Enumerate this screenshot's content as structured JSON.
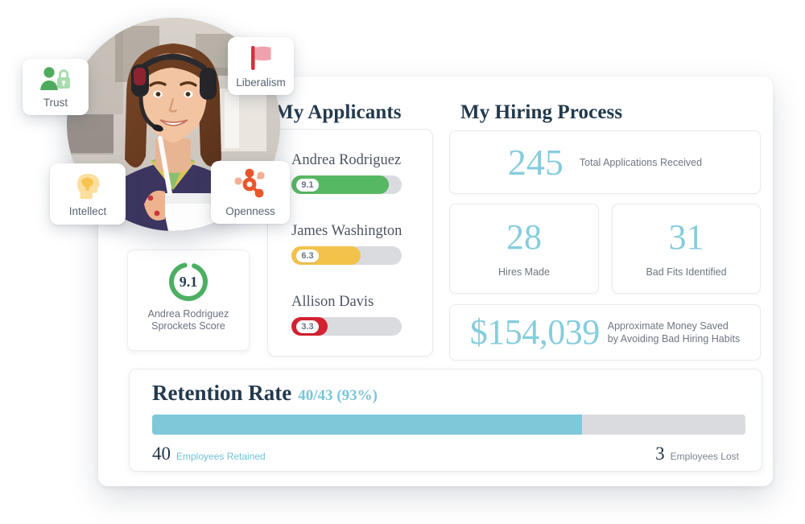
{
  "traits": [
    {
      "id": "trust",
      "label": "Trust",
      "icon": "person-lock-icon",
      "color": "#5cb36a"
    },
    {
      "id": "liberalism",
      "label": "Liberalism",
      "icon": "flag-icon",
      "color": "#e4707e"
    },
    {
      "id": "intellect",
      "label": "Intellect",
      "icon": "brain-head-icon",
      "color": "#f7cf74"
    },
    {
      "id": "openness",
      "label": "Openness",
      "icon": "network-nodes-icon",
      "color": "#e8562a"
    }
  ],
  "photo": {
    "alt": "Smiling employee wearing a headset holding a drink cup"
  },
  "applicants": {
    "title": "My Applicants",
    "items": [
      {
        "name": "Andrea Rodriguez",
        "score": "9.1",
        "percent": 88,
        "color": "#57b863"
      },
      {
        "name": "James Washington",
        "score": "6.3",
        "percent": 63,
        "color": "#f2c24b"
      },
      {
        "name": "Allison Davis",
        "score": "3.3",
        "percent": 33,
        "color": "#d32131"
      }
    ]
  },
  "score_card": {
    "value": "9.1",
    "percent": 91,
    "color": "#4caf62",
    "label_line1": "Andrea Rodriguez",
    "label_line2": "Sprockets Score"
  },
  "hiring": {
    "title": "My Hiring Process",
    "accent": "#85cddd",
    "stats": [
      {
        "id": "total-applications",
        "value": "245",
        "caption": "Total Applications Received"
      },
      {
        "id": "hires-made",
        "value": "28",
        "caption": "Hires Made"
      },
      {
        "id": "bad-fits",
        "value": "31",
        "caption": "Bad Fits Identified"
      }
    ],
    "money": {
      "value": "$154,039",
      "caption_line1": "Approximate Money Saved",
      "caption_line2": "by Avoiding Bad Hiring Habits"
    }
  },
  "retention": {
    "title": "Retention Rate",
    "fraction": "40/43 (93%)",
    "bar_percent": 75,
    "bar_color": "#7ec8d9",
    "retained_value": "40",
    "retained_caption": "Employees Retained",
    "lost_value": "3",
    "lost_caption": "Employees Lost"
  }
}
